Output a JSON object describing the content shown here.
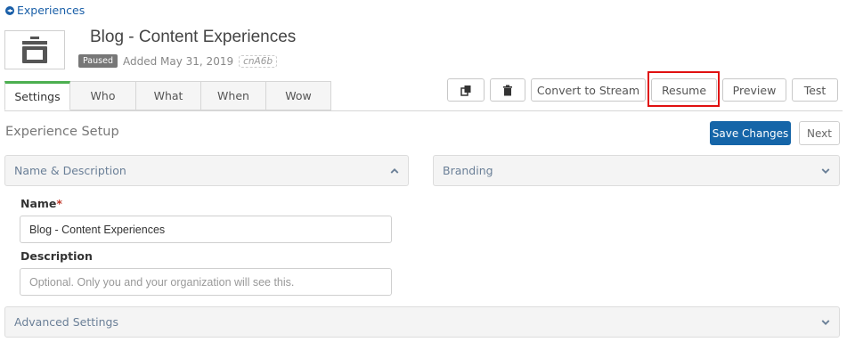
{
  "back_link": {
    "label": "Experiences",
    "icon": "arrow-circle-left-icon"
  },
  "header": {
    "title": "Blog - Content Experiences",
    "status_badge": "Paused",
    "added": "Added May 31, 2019",
    "code": "cnA6b",
    "thumbnail_icon": "toaster-icon"
  },
  "tabs": [
    {
      "label": "Settings",
      "active": true
    },
    {
      "label": "Who",
      "active": false
    },
    {
      "label": "What",
      "active": false
    },
    {
      "label": "When",
      "active": false
    },
    {
      "label": "Wow",
      "active": false
    }
  ],
  "toolbar": {
    "copy_icon": "copy-icon",
    "delete_icon": "trash-icon",
    "convert_label": "Convert to Stream",
    "resume_label": "Resume",
    "preview_label": "Preview",
    "test_label": "Test"
  },
  "section": {
    "title": "Experience Setup",
    "save_label": "Save Changes",
    "next_label": "Next"
  },
  "panels": {
    "name_description": {
      "label": "Name & Description",
      "expanded": true
    },
    "branding": {
      "label": "Branding",
      "expanded": false
    },
    "advanced": {
      "label": "Advanced Settings",
      "expanded": false
    }
  },
  "form": {
    "name_label": "Name",
    "name_required_mark": "*",
    "name_value": "Blog - Content Experiences",
    "description_label": "Description",
    "description_placeholder": "Optional. Only you and your organization will see this."
  },
  "colors": {
    "link": "#1a5fa8",
    "primary_button": "#1565a8",
    "active_tab_accent": "#4caf50",
    "highlight": "#e01010",
    "badge": "#777777"
  }
}
